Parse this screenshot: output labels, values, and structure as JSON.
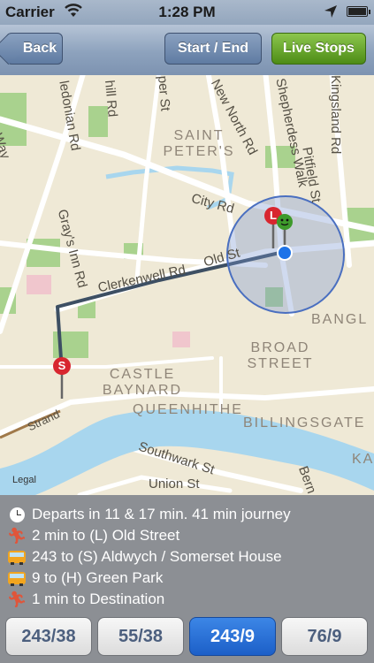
{
  "status_bar": {
    "carrier": "Carrier",
    "time": "1:28 PM"
  },
  "nav": {
    "back_label": "Back",
    "start_end_label": "Start / End",
    "live_stops_label": "Live Stops",
    "live_color": "#5a9a1f"
  },
  "map": {
    "street_labels": [
      "ork Way",
      "ledonian Rd",
      "hill Rd",
      "per St",
      "New North Rd",
      "Shepherdess Walk",
      "Kingsland Rd",
      "Pitfield St",
      "City Rd",
      "Gray's Inn Rd",
      "Clerkenwell Rd",
      "Old St",
      "Southwark St",
      "Union St",
      "Bern",
      "Strand"
    ],
    "area_labels": [
      "SAINT PETER'S",
      "CASTLE BAYNARD",
      "QUEENHITHE",
      "BILLINGSGATE",
      "BROAD STREET",
      "BANGL",
      "KA"
    ],
    "legal": "Legal",
    "route_color": "#3d4f63",
    "markers": {
      "start": "S",
      "end": "L"
    }
  },
  "journey": {
    "rows": [
      {
        "icon": "clock-icon",
        "text": "Departs in 11 & 17 min. 41 min journey"
      },
      {
        "icon": "walking-icon",
        "text": "2 min to (L) Old Street"
      },
      {
        "icon": "bus-icon",
        "text": "243 to (S) Aldwych / Somerset House"
      },
      {
        "icon": "bus-icon",
        "text": "9 to (H) Green Park"
      },
      {
        "icon": "walking-icon",
        "text": "1 min to Destination"
      }
    ]
  },
  "routes_tabs": [
    {
      "label": "243/38",
      "selected": false
    },
    {
      "label": "55/38",
      "selected": false
    },
    {
      "label": "243/9",
      "selected": true
    },
    {
      "label": "76/9",
      "selected": false
    }
  ]
}
